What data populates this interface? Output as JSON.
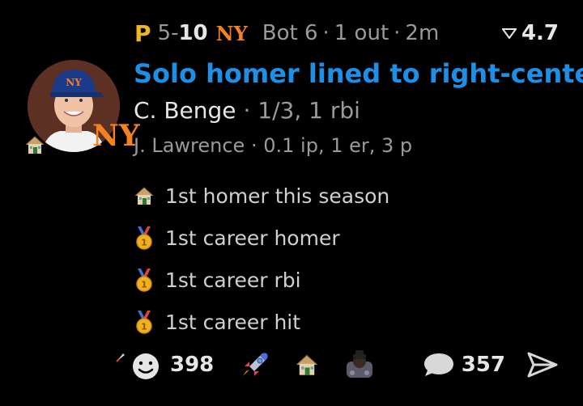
{
  "header": {
    "team_a_icon": "P",
    "score_a": "5",
    "score_sep": "-",
    "score_b": "10",
    "team_b_icon": "NY",
    "inning": "Bot 6",
    "outs": "1 out",
    "time_ago": "2m",
    "dot": "·",
    "ev_icon": "tick-filter-icon",
    "ev_value": "4.7"
  },
  "play": {
    "title": "Solo homer lined to right-center",
    "batter_name": "C. Benge",
    "batter_stats": "1/3, 1 rbi",
    "pitcher_name": "J. Lawrence",
    "pitcher_stats": "0.1 ip, 1 er, 3 p",
    "team_logo": "NY"
  },
  "notes": [
    {
      "icon": "house-icon",
      "text": "1st homer this season"
    },
    {
      "icon": "medal-icon",
      "text": "1st career homer"
    },
    {
      "icon": "medal-icon",
      "text": "1st career rbi"
    },
    {
      "icon": "medal-icon",
      "text": "1st career hit"
    }
  ],
  "footer": {
    "reaction_count": "398",
    "comment_count": "357"
  },
  "colors": {
    "title_blue": "#1d8fe6",
    "pirates_gold": "#f0b429",
    "mets_orange": "#f58220",
    "mets_blue": "#1b3a8a",
    "background": "#000000"
  }
}
